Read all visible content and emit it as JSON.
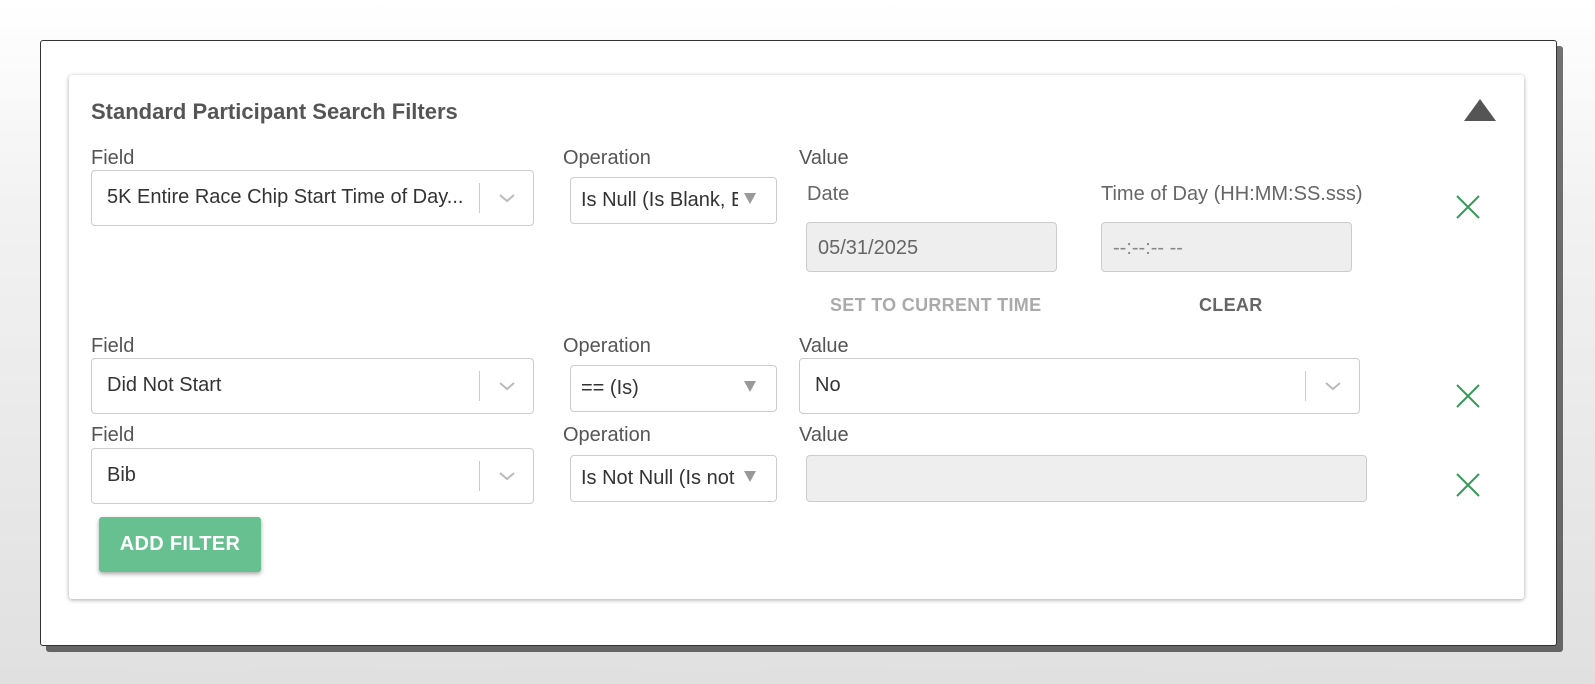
{
  "panel": {
    "title": "Standard Participant Search Filters"
  },
  "filters": [
    {
      "field_label": "Field",
      "field_value": "5K Entire Race Chip Start Time of Day...",
      "operation_label": "Operation",
      "operation_value": "Is Null (Is Blank, Empty)",
      "value_label": "Value",
      "date_label": "Date",
      "date_value": "05/31/2025",
      "time_label": "Time of Day (HH:MM:SS.sss)",
      "time_placeholder": "--:--:-- --",
      "set_current_label": "SET TO CURRENT TIME",
      "clear_label": "CLEAR"
    },
    {
      "field_label": "Field",
      "field_value": "Did Not Start",
      "operation_label": "Operation",
      "operation_value": "== (Is)",
      "value_label": "Value",
      "value_value": "No"
    },
    {
      "field_label": "Field",
      "field_value": "Bib",
      "operation_label": "Operation",
      "operation_value": "Is Not Null (Is not Blank)",
      "value_label": "Value",
      "value_value": ""
    }
  ],
  "actions": {
    "add_filter_label": "ADD FILTER"
  },
  "icons": {
    "collapse": "triangle-up-icon",
    "remove": "close-x-icon",
    "dropdown": "chevron-down-icon"
  },
  "colors": {
    "accent_green": "#67c08f",
    "remove_icon": "#3a9a5c",
    "collapse_icon": "#555555"
  }
}
